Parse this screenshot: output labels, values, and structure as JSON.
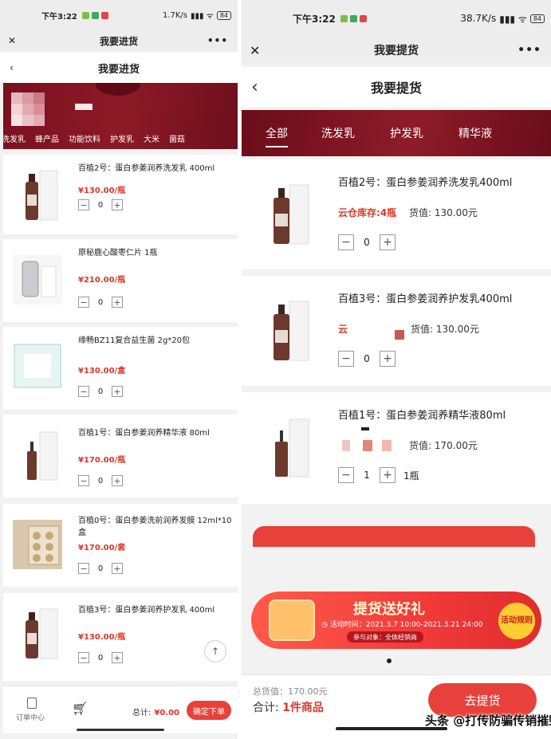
{
  "left": {
    "status": {
      "time": "下午3:22",
      "speed": "1.7K/s",
      "battery": "84"
    },
    "window_title": "我要进货",
    "page_title": "我要进货",
    "categories": [
      "洗发乳",
      "蜂产品",
      "功能饮料",
      "护发乳",
      "大米",
      "菌菇"
    ],
    "products": [
      {
        "name": "百植2号：蛋白参姜润养洗发乳 400ml",
        "price": "¥130.00/瓶",
        "qty": "0"
      },
      {
        "name": "原秘鹿心酸枣仁片 1瓶",
        "price": "¥210.00/瓶",
        "qty": "0"
      },
      {
        "name": "缘畅BZ11复合益生菌 2g*20包",
        "price": "¥130.00/盒",
        "qty": "0"
      },
      {
        "name": "百植1号：蛋白参姜润养精华液 80ml",
        "price": "¥170.00/瓶",
        "qty": "0"
      },
      {
        "name": "百植0号：蛋白参姜洗前润养发膜 12ml*10盒",
        "price": "¥170.00/套",
        "qty": "0"
      },
      {
        "name": "百植3号：蛋白参姜润养护发乳 400ml",
        "price": "¥130.00/瓶",
        "qty": "0"
      }
    ],
    "footer": {
      "order_center": "订单中心",
      "total_label": "总计:",
      "total_value": "¥0.00",
      "confirm": "确定下单"
    }
  },
  "right": {
    "status": {
      "time": "下午3:22",
      "speed": "38.7K/s",
      "battery": "84"
    },
    "window_title": "我要提货",
    "page_title": "我要提货",
    "tabs": [
      "全部",
      "洗发乳",
      "护发乳",
      "精华液"
    ],
    "products": [
      {
        "name": "百植2号：蛋白参姜润养洗发乳400ml",
        "stock": "云仓库存:4瓶",
        "value": "货值: 130.00元",
        "qty": "0",
        "unit": ""
      },
      {
        "name": "百植3号：蛋白参姜润养护发乳400ml",
        "stock": "云",
        "value": "货值: 130.00元",
        "qty": "0",
        "unit": ""
      },
      {
        "name": "百植1号：蛋白参姜润养精华液80ml",
        "stock": "",
        "value": "货值: 170.00元",
        "qty": "1",
        "unit": "1瓶"
      }
    ],
    "promo": {
      "title": "提货送好礼",
      "time": "活动时间：2021.3.7 10:00-2021.3.21 24:00",
      "target": "参与对象：全体经销商",
      "rule": "活动规则"
    },
    "footer": {
      "goods_value": "总货值：170.00元",
      "sum_label": "合计: ",
      "sum_value": "1件商品",
      "pickup": "去提货"
    },
    "watermark": "头条 @打传防骗传销摧毁者"
  },
  "colors": {
    "accent": "#e8413b",
    "banner": "#8c1a26",
    "price": "#d9382a"
  }
}
